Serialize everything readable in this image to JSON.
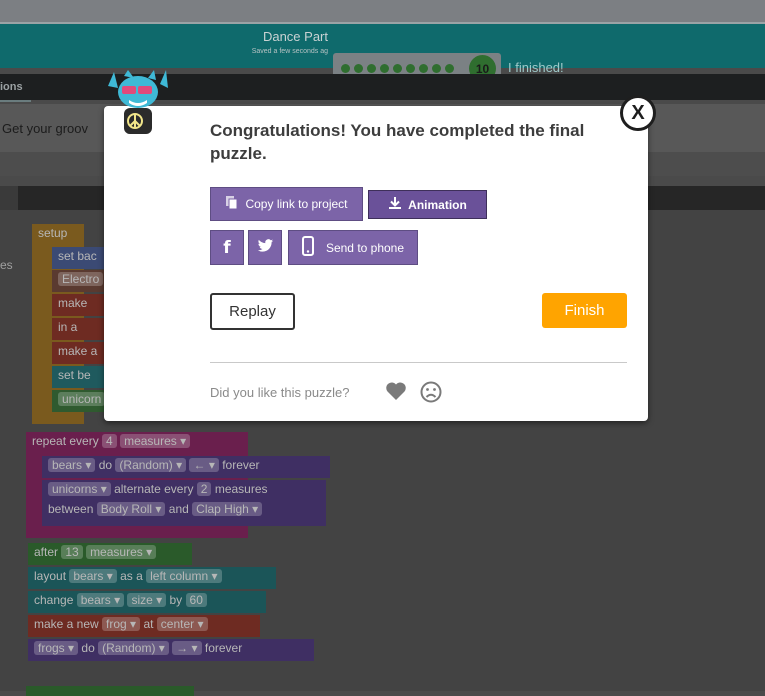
{
  "header": {
    "level_name": "Dance Part",
    "saved_text": "Saved a few seconds ag",
    "level_number": "10",
    "finished_label": "I finished!"
  },
  "tabs": {
    "instructions_partial": "ions"
  },
  "instructions": {
    "text_partial": "Get your groov"
  },
  "workspace": {
    "left_label_partial": "es",
    "setup_block": {
      "label": "setup",
      "lines": [
        "set bac",
        "Electro",
        "make",
        "in a",
        "make a",
        "set be",
        "unicorn"
      ]
    },
    "repeat_block": {
      "keyword": "repeat every",
      "count": "4",
      "unit": "measures ▾",
      "row1": [
        "bears ▾",
        "do",
        "(Random) ▾",
        "← ▾",
        "forever"
      ],
      "row2": [
        "unicorns ▾",
        "alternate every",
        "2",
        "measures"
      ],
      "row3": [
        "between",
        "Body Roll ▾",
        "and",
        "Clap High ▾"
      ]
    },
    "after_block": {
      "keyword": "after",
      "count": "13",
      "unit": "measures ▾"
    },
    "layout_block": [
      "layout",
      "bears ▾",
      "as a",
      "left column ▾"
    ],
    "change_block": [
      "change",
      "bears ▾",
      "size ▾",
      "by",
      "60"
    ],
    "make_block": [
      "make a new",
      "frog ▾",
      "at",
      "center ▾"
    ],
    "frogs_block": [
      "frogs ▾",
      "do",
      "(Random) ▾",
      "→ ▾",
      "forever"
    ]
  },
  "modal": {
    "title": "Congratulations! You have completed the final puzzle.",
    "copy_link_label": "Copy link to project",
    "animation_label": "Animation",
    "send_to_phone_label": "Send to phone",
    "replay_label": "Replay",
    "finish_label": "Finish",
    "feedback_question": "Did you like this puzzle?",
    "close_label": "X"
  },
  "colors": {
    "accent_purple": "#7c64a8",
    "finish_orange": "#ffa400",
    "header_teal": "#0f6a6c"
  }
}
